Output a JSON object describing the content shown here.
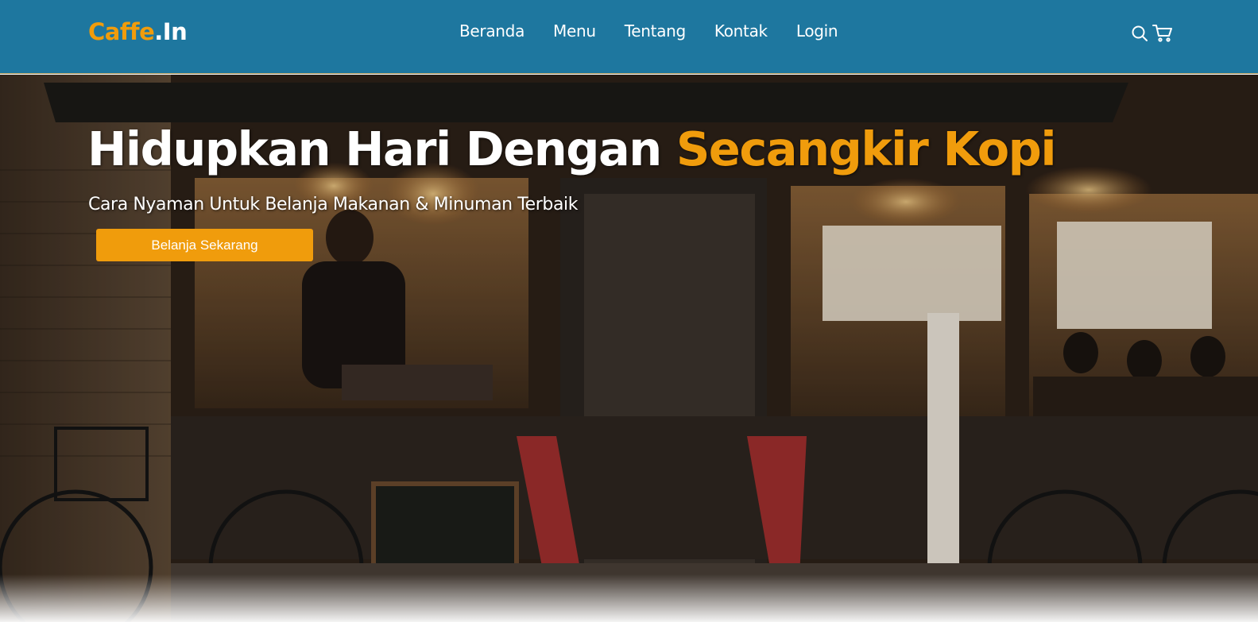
{
  "brand": {
    "name_part1": "Caffe",
    "name_part2": ".In"
  },
  "nav": {
    "links": [
      {
        "label": "Beranda"
      },
      {
        "label": "Menu"
      },
      {
        "label": "Tentang"
      },
      {
        "label": "Kontak"
      },
      {
        "label": "Login"
      }
    ],
    "icons": [
      "search-icon",
      "shopping-cart-icon"
    ]
  },
  "hero": {
    "title_white": "Hidupkan Hari Dengan",
    "title_accent": "Secangkir Kopi",
    "subtitle": "Cara Nyaman Untuk Belanja Makanan & Minuman Terbaik",
    "cta_label": "Belanja Sekarang",
    "background": "night-restaurant-storefront-photo"
  },
  "colors": {
    "navbar_bg": "#1e779f",
    "accent": "#f09c0c",
    "text_light": "#ffffff"
  }
}
